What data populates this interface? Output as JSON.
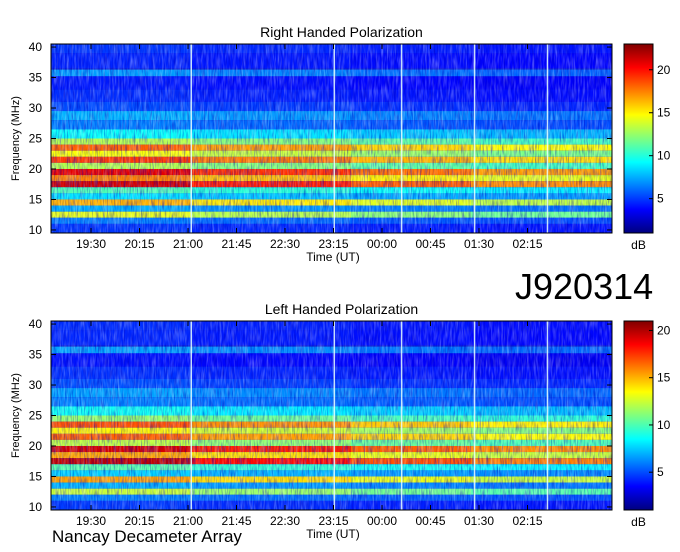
{
  "chart_data": [
    {
      "type": "heatmap",
      "title": "Right Handed Polarization",
      "xlabel": "Time (UT)",
      "ylabel": "Frequency (MHz)",
      "x_ticks": [
        "19:30",
        "20:15",
        "21:00",
        "21:45",
        "22:30",
        "23:15",
        "00:00",
        "00:45",
        "01:30",
        "02:15"
      ],
      "y_ticks": [
        "10",
        "15",
        "20",
        "25",
        "30",
        "35",
        "40"
      ],
      "ylim": [
        9.5,
        40.5
      ],
      "colorbar_label": "dB",
      "colorbar_ticks": [
        "5",
        "10",
        "15",
        "20"
      ],
      "colorbar_range": [
        1,
        23
      ],
      "colormap": "jet"
    },
    {
      "type": "heatmap",
      "title": "Left Handed Polarization",
      "xlabel": "Time (UT)",
      "ylabel": "Frequency (MHz)",
      "x_ticks": [
        "19:30",
        "20:15",
        "21:00",
        "21:45",
        "22:30",
        "23:15",
        "00:00",
        "00:45",
        "01:30",
        "02:15"
      ],
      "y_ticks": [
        "10",
        "15",
        "20",
        "25",
        "30",
        "35",
        "40"
      ],
      "ylim": [
        9.5,
        40.5
      ],
      "colorbar_label": "dB",
      "colorbar_ticks": [
        "5",
        "10",
        "15",
        "20"
      ],
      "colorbar_range": [
        1,
        21
      ],
      "colormap": "jet"
    }
  ],
  "event_id": "J920314",
  "instrument": "Nancay Decameter Array"
}
